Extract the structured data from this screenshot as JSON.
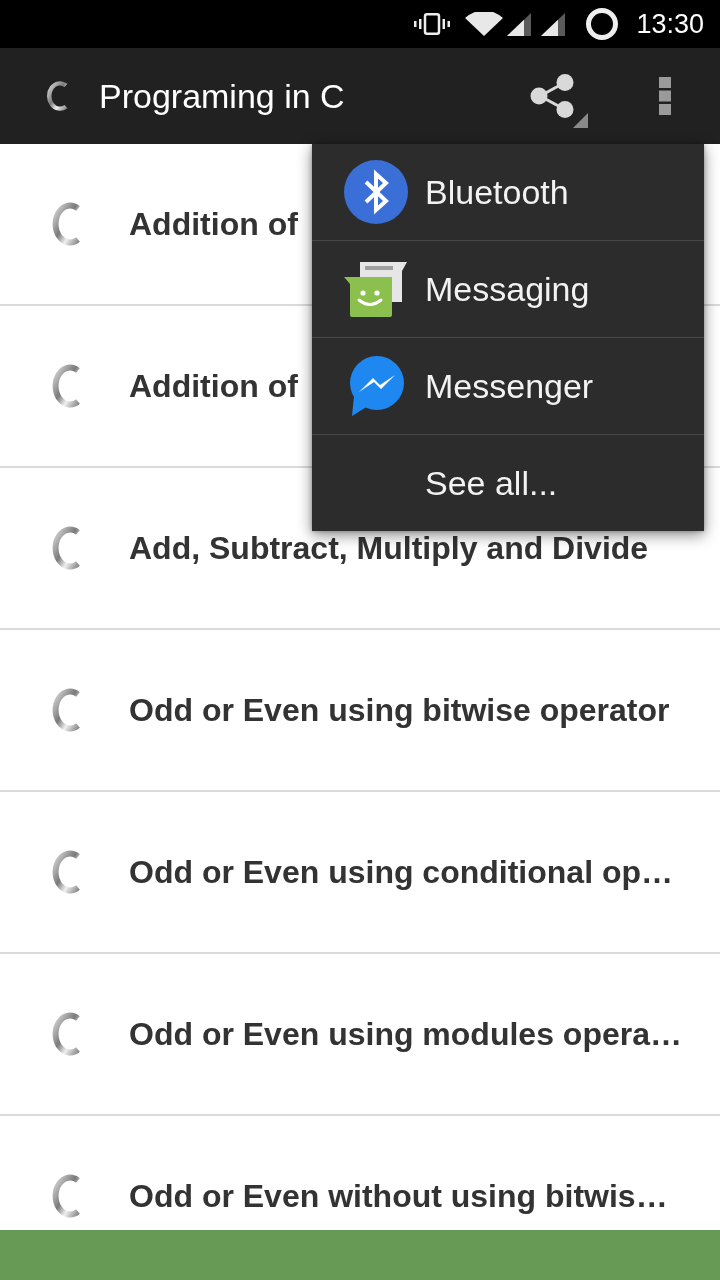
{
  "status_bar": {
    "time": "13:30"
  },
  "app_bar": {
    "title": "Programing in C"
  },
  "topics": [
    {
      "title": "Addition of"
    },
    {
      "title": "Addition of"
    },
    {
      "title": "Add, Subtract, Multiply and Divide"
    },
    {
      "title": "Odd or Even using bitwise operator"
    },
    {
      "title": "Odd or Even using conditional op…"
    },
    {
      "title": "Odd or Even using modules opera…"
    },
    {
      "title": "Odd or Even without using bitwis…"
    }
  ],
  "share_menu": {
    "items": [
      {
        "label": "Bluetooth",
        "kind": "app"
      },
      {
        "label": "Messaging",
        "kind": "app"
      },
      {
        "label": "Messenger",
        "kind": "app"
      },
      {
        "label": "See all...",
        "kind": "more"
      }
    ]
  }
}
